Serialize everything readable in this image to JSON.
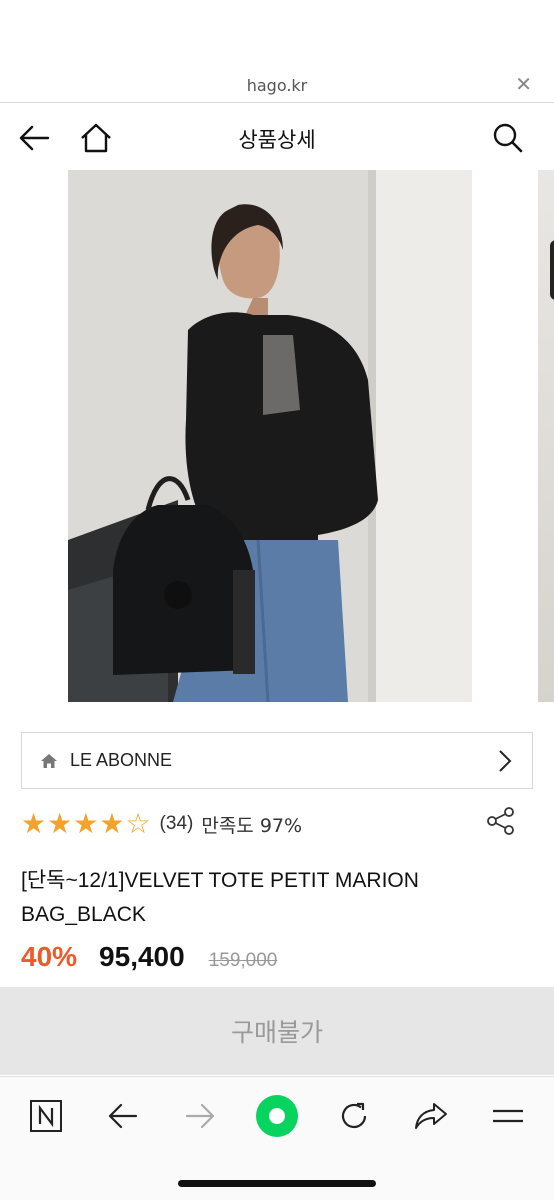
{
  "browser": {
    "domain": "hago.kr",
    "close_icon": "close-icon"
  },
  "header": {
    "title": "상품상세",
    "back_icon": "arrow-left-icon",
    "home_icon": "home-icon",
    "search_icon": "search-icon"
  },
  "gallery": {
    "image": "woman-with-black-velvet-bag-photo"
  },
  "brand": {
    "name": "LE ABONNE",
    "icon": "home-icon",
    "chevron": "chevron-right-icon"
  },
  "rating": {
    "stars": 4.5,
    "count": "(34)",
    "satisfaction": "만족도 97%",
    "share_icon": "share-icon"
  },
  "product": {
    "title": "[단독~12/1]VELVET TOTE PETIT MARION BAG_BLACK"
  },
  "price": {
    "discount": "40%",
    "sale": "95,400",
    "original": "159,000"
  },
  "purchase": {
    "label": "구매불가"
  },
  "toolbar": {
    "items": [
      "naver-n-icon",
      "back-arrow-icon",
      "forward-arrow-icon",
      "green-dot-icon",
      "refresh-icon",
      "share-arrow-icon",
      "menu-icon"
    ]
  },
  "colors": {
    "accent_discount": "#f05a28",
    "star": "#f3a32c",
    "green": "#03c75a"
  }
}
